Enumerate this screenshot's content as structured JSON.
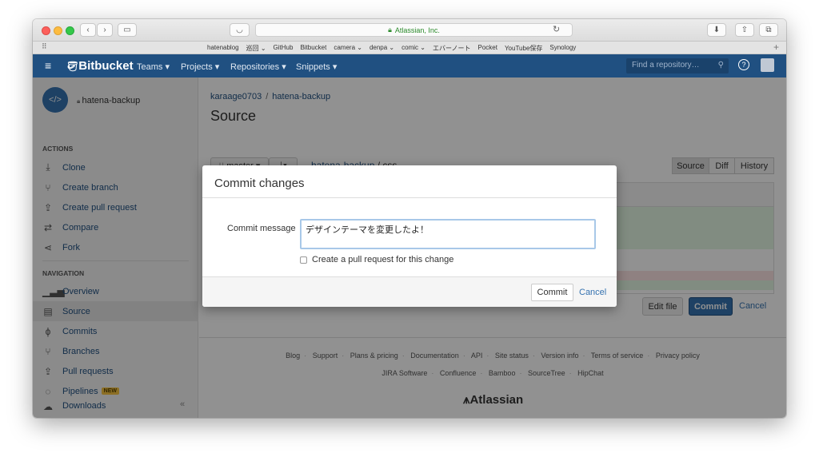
{
  "browser": {
    "address": "Atlassian, Inc.",
    "bookmarks": [
      "hatenablog",
      "巡回 ⌄",
      "GitHub",
      "Bitbucket",
      "camera ⌄",
      "denpa ⌄",
      "comic ⌄",
      "エバーノート",
      "Pocket",
      "YouTube保存",
      "Synology"
    ]
  },
  "appnav": {
    "logo": "Bitbucket",
    "menus": [
      "Teams ▾",
      "Projects ▾",
      "Repositories ▾",
      "Snippets ▾"
    ],
    "search_placeholder": "Find a repository…"
  },
  "sidebar": {
    "repo_name": "hatena-backup",
    "actions_heading": "ACTIONS",
    "actions": [
      "Clone",
      "Create branch",
      "Create pull request",
      "Compare",
      "Fork"
    ],
    "navigation_heading": "NAVIGATION",
    "navigation": [
      "Overview",
      "Source",
      "Commits",
      "Branches",
      "Pull requests",
      "Pipelines",
      "Downloads"
    ],
    "new_badge": "NEW"
  },
  "main": {
    "breadcrumb_user": "karaage0703",
    "breadcrumb_sep": "/",
    "breadcrumb_repo": "hatena-backup",
    "title": "Source",
    "branch": "master ▾",
    "path_repo": "hatena-backup",
    "path_rest": " / css",
    "tabs": [
      "Source",
      "Diff",
      "History"
    ],
    "edit_file": "Edit file",
    "commit": "Commit",
    "cancel": "Cancel"
  },
  "footer": {
    "links_row1": [
      "Blog",
      "Support",
      "Plans & pricing",
      "Documentation",
      "API",
      "Site status",
      "Version info",
      "Terms of service",
      "Privacy policy"
    ],
    "links_row2": [
      "JIRA Software",
      "Confluence",
      "Bamboo",
      "SourceTree",
      "HipChat"
    ],
    "brand": "Atlassian"
  },
  "modal": {
    "title": "Commit changes",
    "label": "Commit message",
    "message": "デザインテーマを変更したよ！",
    "checkbox_label": "Create a pull request for this change",
    "commit": "Commit",
    "cancel": "Cancel"
  },
  "colors": {
    "nav": "#205081",
    "link": "#3572b0",
    "primary": "#205081"
  }
}
